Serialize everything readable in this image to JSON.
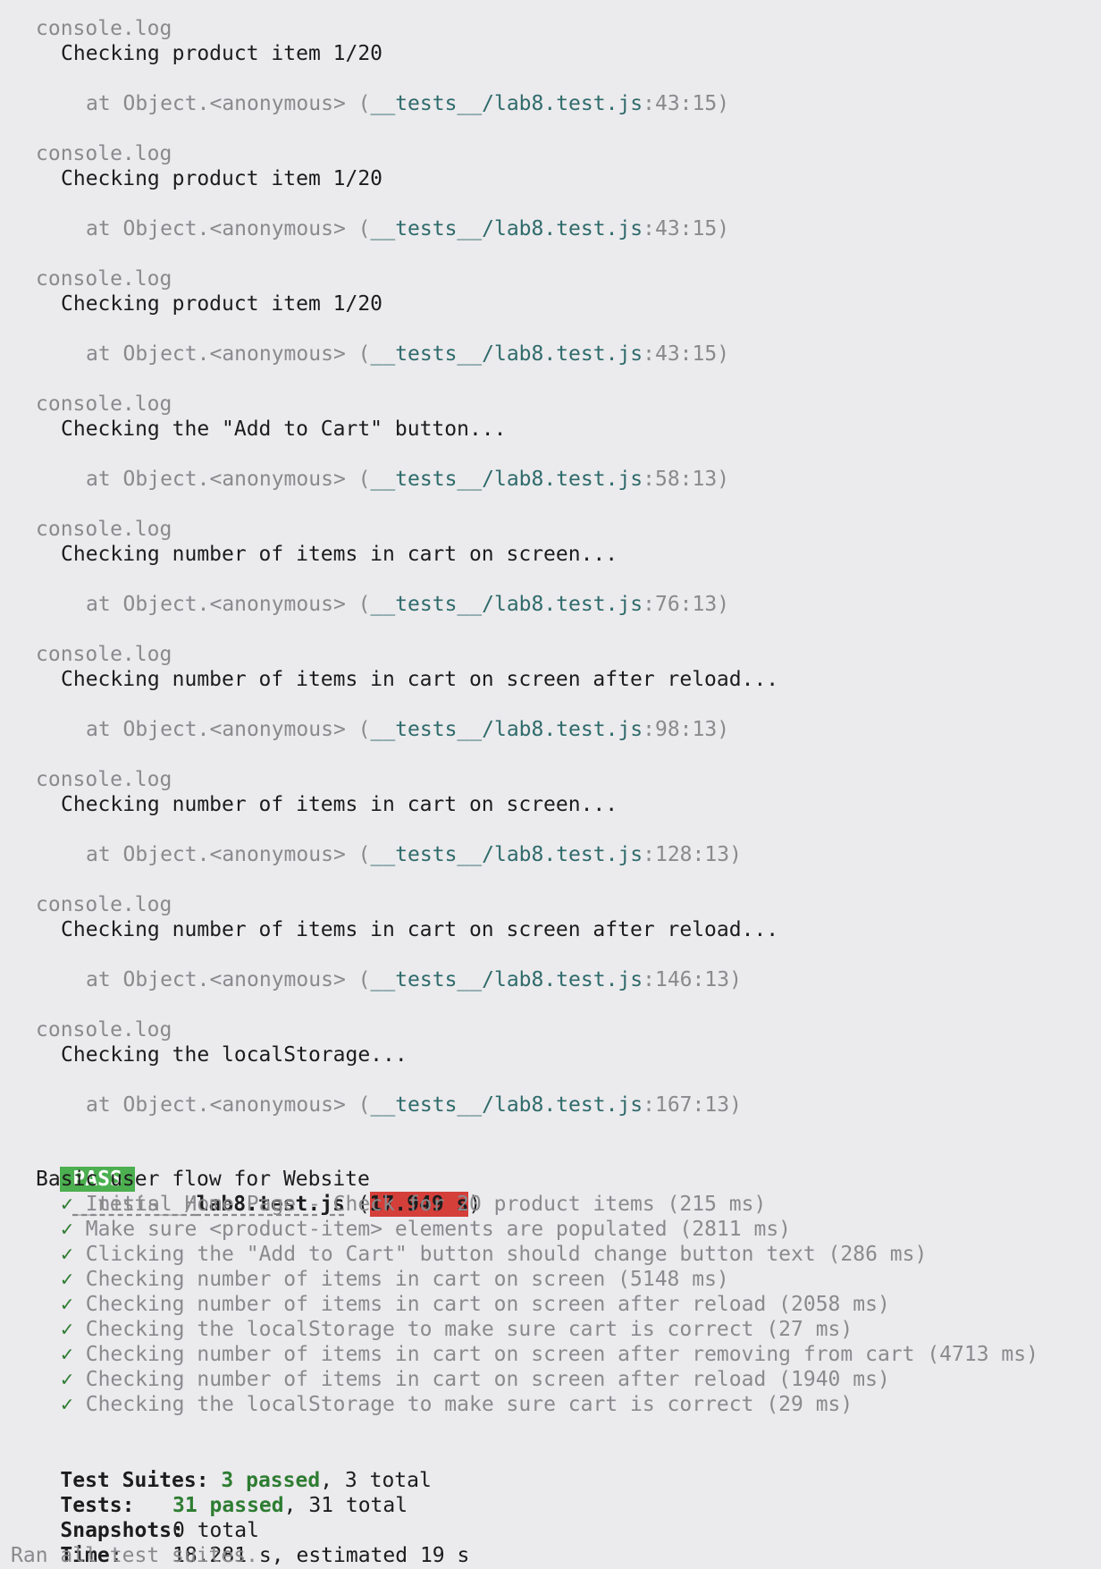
{
  "logs": [
    {
      "header": "console.log",
      "message": "Checking product item 1/20",
      "at_prefix": "at Object.<anonymous> (",
      "file": "__tests__/lab8.test.js",
      "loc": ":43:15)"
    },
    {
      "header": "console.log",
      "message": "Checking product item 1/20",
      "at_prefix": "at Object.<anonymous> (",
      "file": "__tests__/lab8.test.js",
      "loc": ":43:15)"
    },
    {
      "header": "console.log",
      "message": "Checking product item 1/20",
      "at_prefix": "at Object.<anonymous> (",
      "file": "__tests__/lab8.test.js",
      "loc": ":43:15)"
    },
    {
      "header": "console.log",
      "message": "Checking the \"Add to Cart\" button...",
      "at_prefix": "at Object.<anonymous> (",
      "file": "__tests__/lab8.test.js",
      "loc": ":58:13)"
    },
    {
      "header": "console.log",
      "message": "Checking number of items in cart on screen...",
      "at_prefix": "at Object.<anonymous> (",
      "file": "__tests__/lab8.test.js",
      "loc": ":76:13)"
    },
    {
      "header": "console.log",
      "message": "Checking number of items in cart on screen after reload...",
      "at_prefix": "at Object.<anonymous> (",
      "file": "__tests__/lab8.test.js",
      "loc": ":98:13)"
    },
    {
      "header": "console.log",
      "message": "Checking number of items in cart on screen...",
      "at_prefix": "at Object.<anonymous> (",
      "file": "__tests__/lab8.test.js",
      "loc": ":128:13)"
    },
    {
      "header": "console.log",
      "message": "Checking number of items in cart on screen after reload...",
      "at_prefix": "at Object.<anonymous> (",
      "file": "__tests__/lab8.test.js",
      "loc": ":146:13)"
    },
    {
      "header": "console.log",
      "message": "Checking the localStorage...",
      "at_prefix": "at Object.<anonymous> (",
      "file": "__tests__/lab8.test.js",
      "loc": ":167:13)"
    }
  ],
  "result": {
    "badge": "PASS",
    "file_dir": "__tests__/",
    "file_name": "lab8.test.js",
    "open_paren": " (",
    "duration": "17.949 s",
    "close_paren": ")",
    "suite": "Basic user flow for Website",
    "check_mark": "✓",
    "tests": [
      "Initial Home Page - Check for 20 product items (215 ms)",
      "Make sure <product-item> elements are populated (2811 ms)",
      "Clicking the \"Add to Cart\" button should change button text (286 ms)",
      "Checking number of items in cart on screen (5148 ms)",
      "Checking number of items in cart on screen after reload (2058 ms)",
      "Checking the localStorage to make sure cart is correct (27 ms)",
      "Checking number of items in cart on screen after removing from cart (4713 ms)",
      "Checking number of items in cart on screen after reload (1940 ms)",
      "Checking the localStorage to make sure cart is correct (29 ms)"
    ]
  },
  "summary": {
    "suites_label": "Test Suites:",
    "suites_passed": "3 passed",
    "suites_total": ", 3 total",
    "tests_label": "Tests:",
    "tests_passed": "31 passed",
    "tests_total": ", 31 total",
    "snapshots_label": "Snapshots:",
    "snapshots_value": "0 total",
    "time_label": "Time:",
    "time_value": "18.281 s, estimated 19 s",
    "footer": "Ran all test suites."
  }
}
